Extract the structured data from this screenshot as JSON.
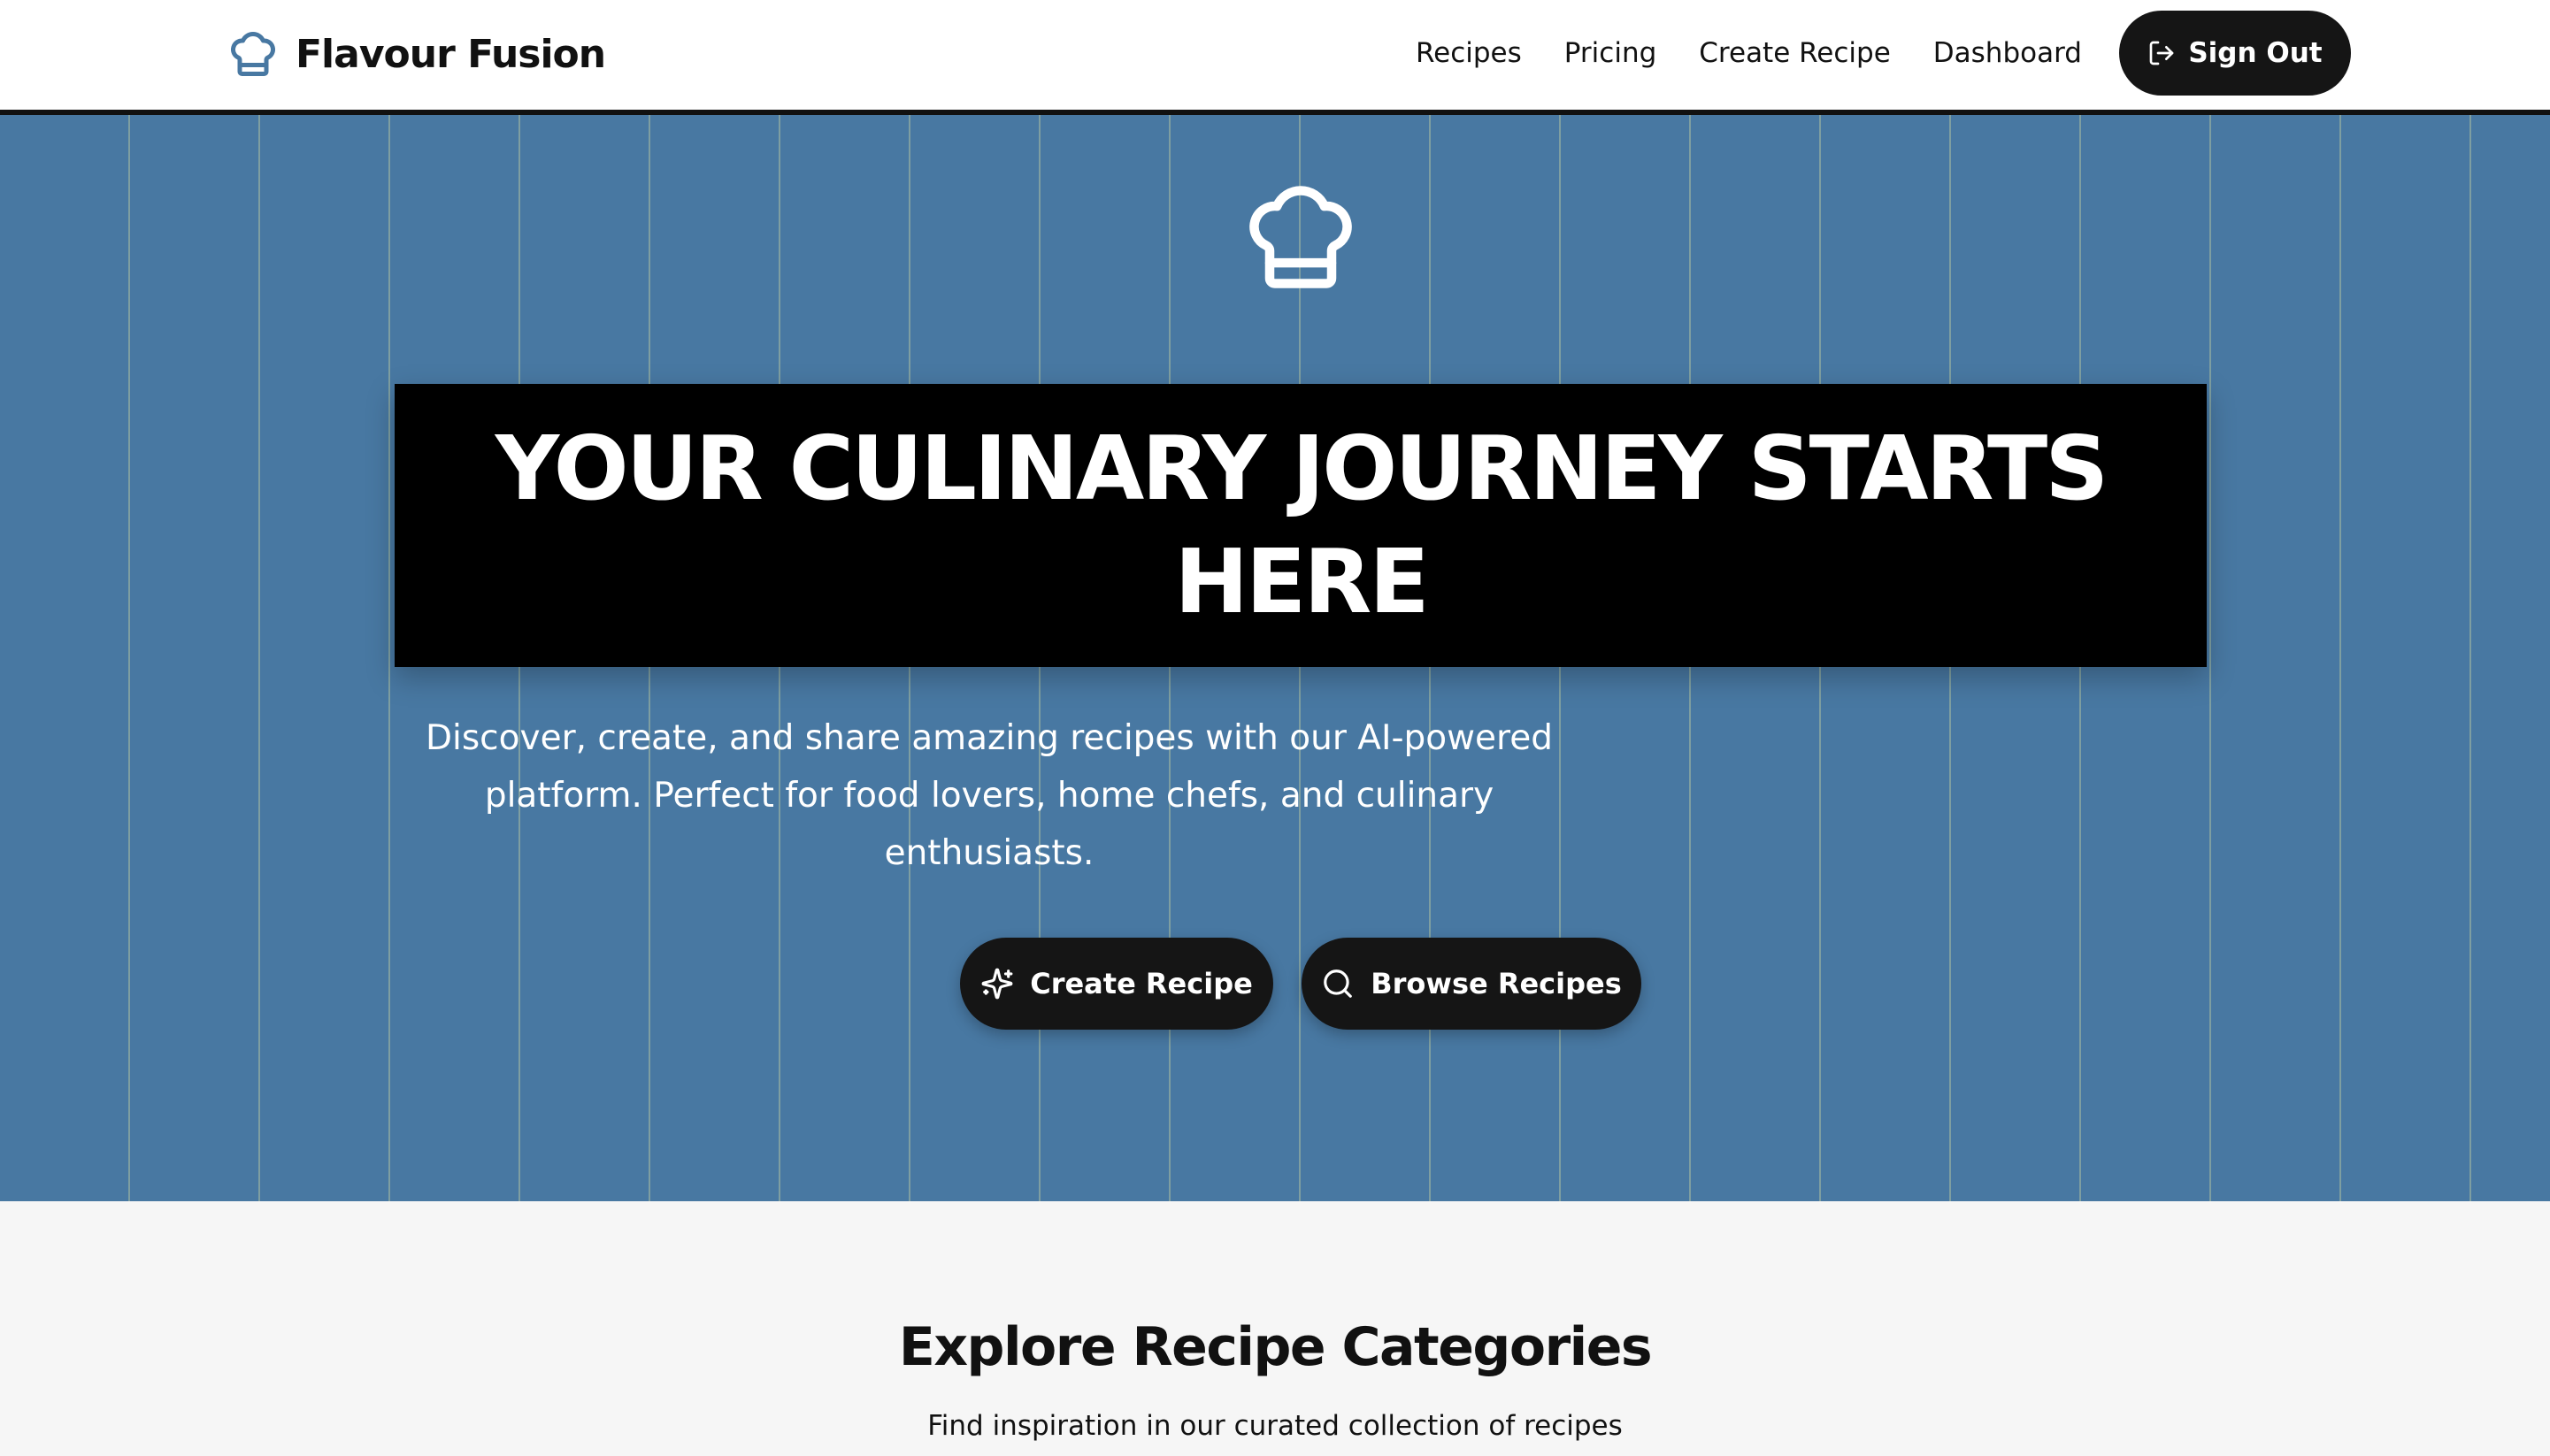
{
  "brand": {
    "name": "Flavour Fusion",
    "icon": "chef-hat-icon",
    "color": "#4878a2"
  },
  "nav": {
    "links": [
      "Recipes",
      "Pricing",
      "Create Recipe",
      "Dashboard"
    ],
    "sign_out": {
      "label": "Sign Out",
      "icon": "log-out-icon"
    }
  },
  "hero": {
    "icon": "chef-hat-icon",
    "headline": "YOUR CULINARY JOURNEY STARTS HERE",
    "subtitle": "Discover, create, and share amazing recipes with our AI-powered platform. Perfect for food lovers, home chefs, and culinary enthusiasts.",
    "buttons": [
      {
        "label": "Create Recipe",
        "icon": "sparkles-icon"
      },
      {
        "label": "Browse Recipes",
        "icon": "search-icon"
      }
    ],
    "background": "#4878a2"
  },
  "categories": {
    "title": "Explore Recipe Categories",
    "subtitle": "Find inspiration in our curated collection of recipes"
  },
  "colors": {
    "dark": "#151515",
    "text": "#111111",
    "page_bg": "#f6f6f6"
  }
}
